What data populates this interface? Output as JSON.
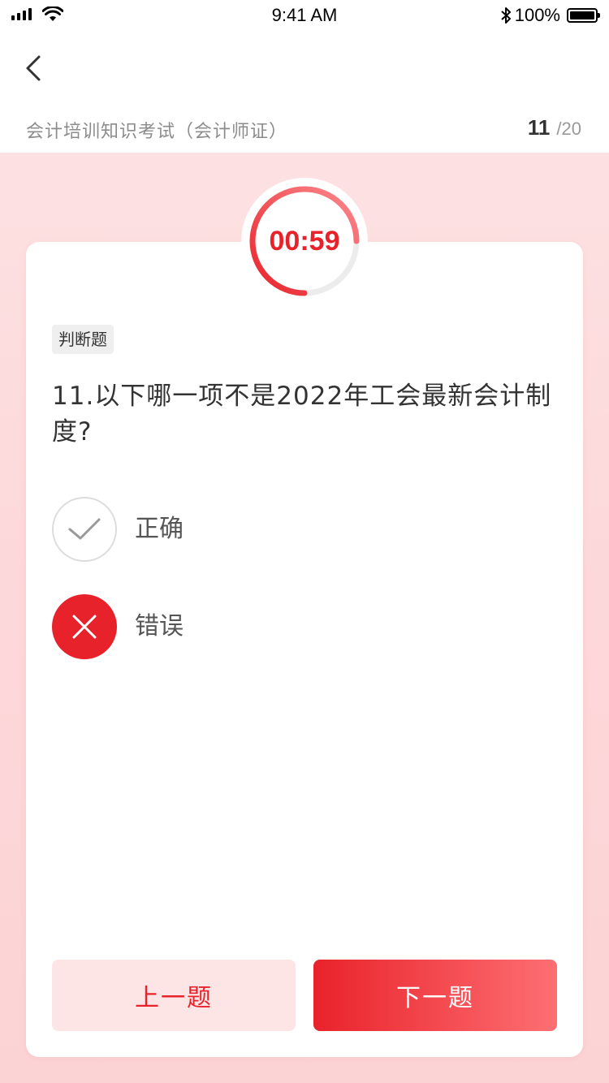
{
  "status_bar": {
    "time": "9:41 AM",
    "battery": "100%",
    "battery_level": 1.0
  },
  "nav": {
    "back_icon": "chevron-left-icon"
  },
  "exam": {
    "title": "会计培训知识考试（会计师证）",
    "current": "11",
    "total": "/20"
  },
  "timer": {
    "text": "00:59",
    "remaining_fraction": 0.75,
    "color": "#e8222a"
  },
  "question": {
    "type_label": "判断题",
    "text": "11.以下哪一项不是2022年工会最新会计制度?"
  },
  "options": [
    {
      "label": "正确",
      "icon": "check-icon",
      "selected": false
    },
    {
      "label": "错误",
      "icon": "close-icon",
      "selected": true
    }
  ],
  "buttons": {
    "prev": "上一题",
    "next": "下一题"
  },
  "colors": {
    "accent": "#e8222a",
    "background": "#fddcde"
  }
}
